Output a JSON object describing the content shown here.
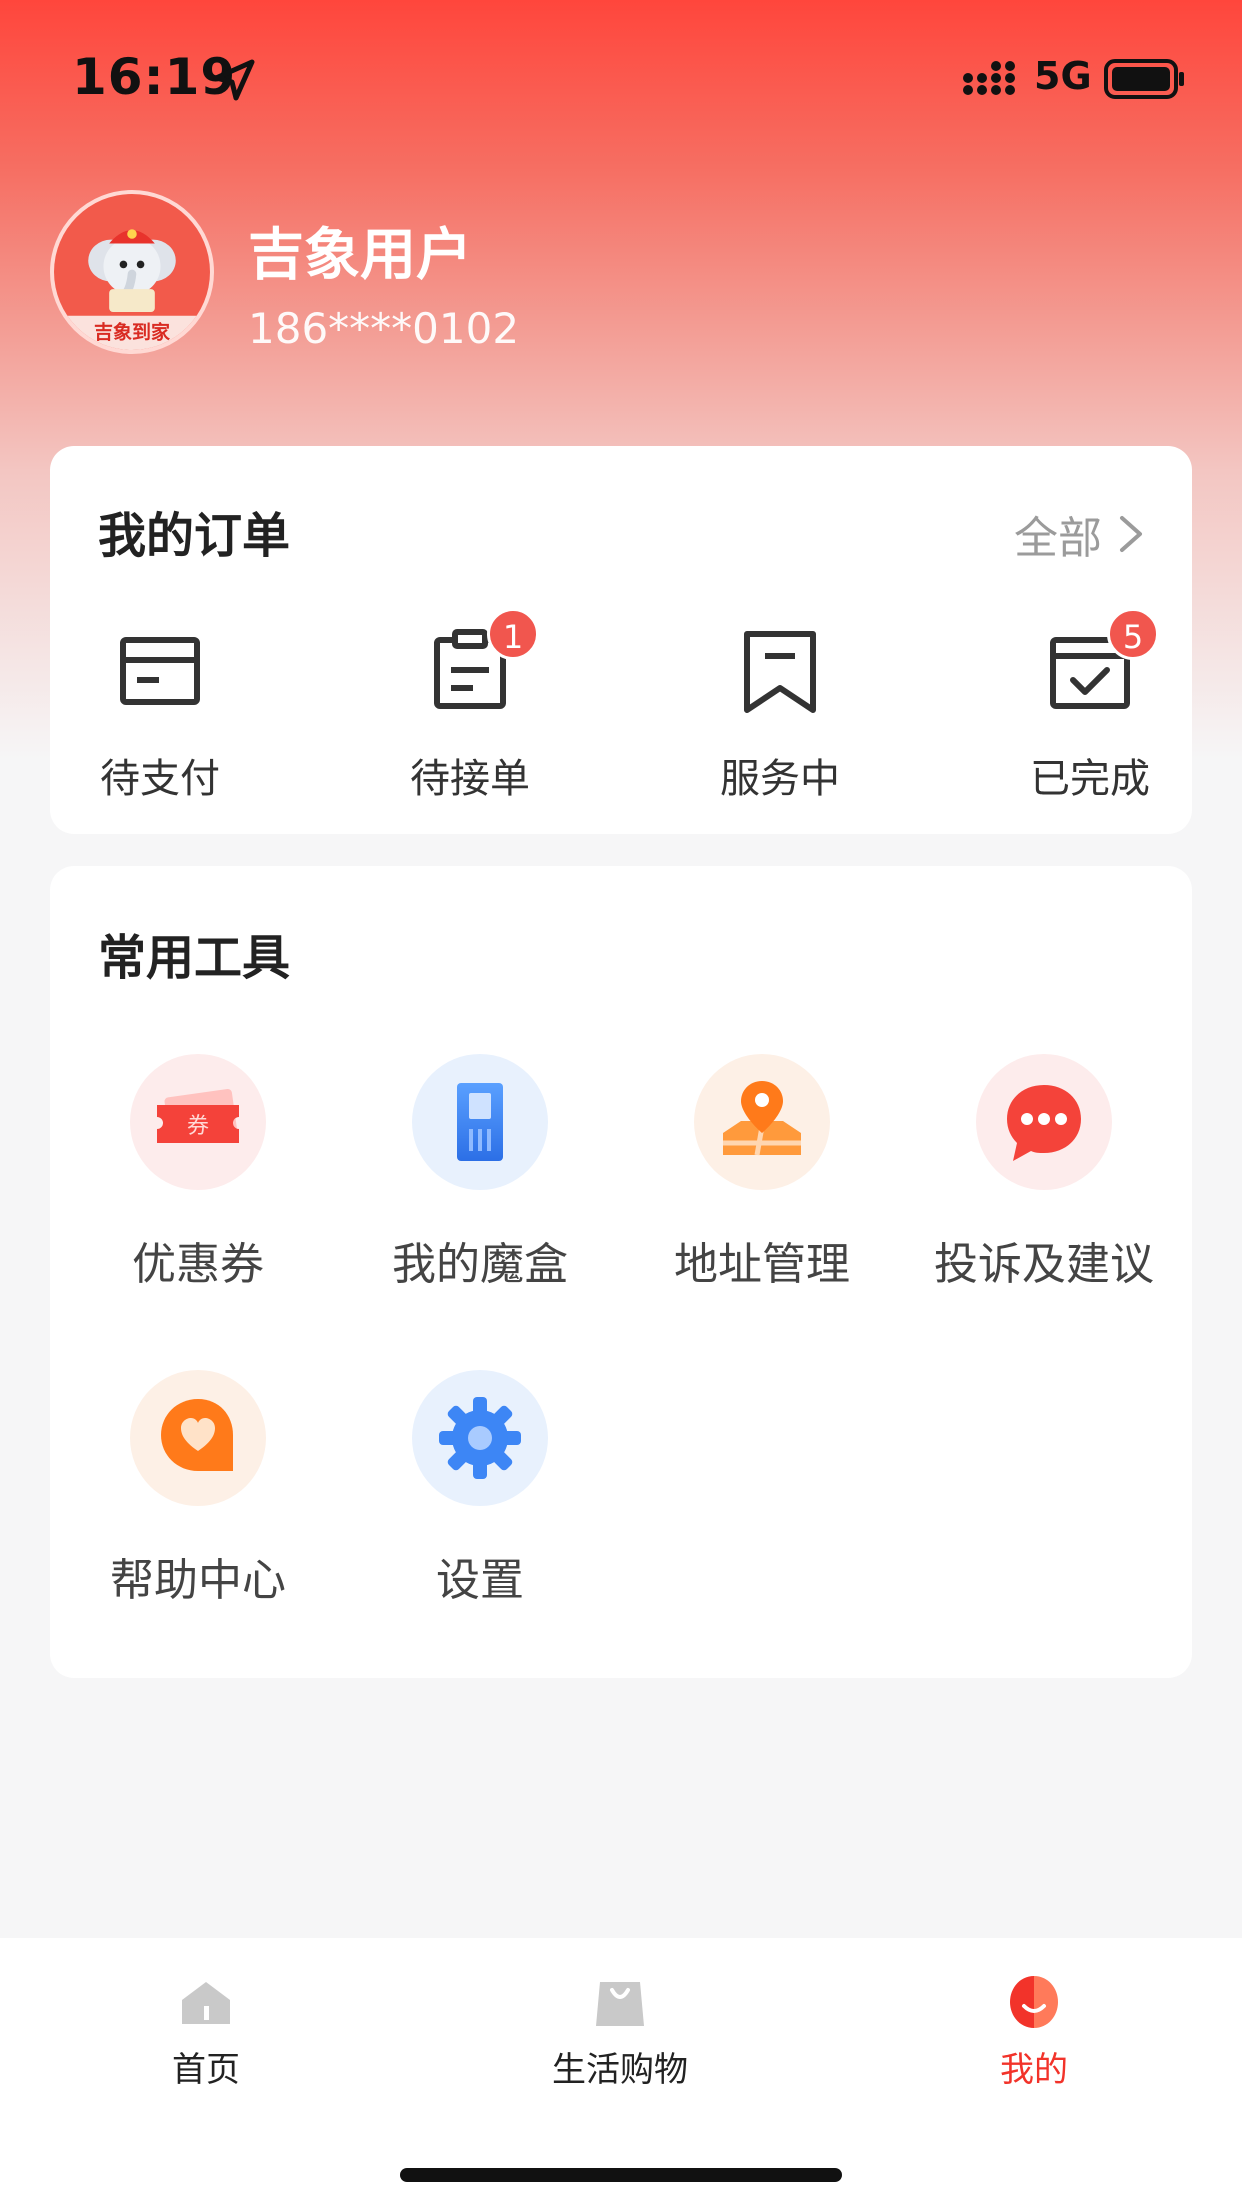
{
  "status_bar": {
    "time": "16:19",
    "network": "5G"
  },
  "profile": {
    "nickname": "吉象用户",
    "phone": "186****0102",
    "avatar_caption": "吉象到家"
  },
  "orders": {
    "title": "我的订单",
    "all_label": "全部",
    "items": [
      {
        "label": "待支付",
        "icon": "wallet-card-icon",
        "badge": ""
      },
      {
        "label": "待接单",
        "icon": "clipboard-icon",
        "badge": "1"
      },
      {
        "label": "服务中",
        "icon": "bookmark-icon",
        "badge": ""
      },
      {
        "label": "已完成",
        "icon": "calendar-check-icon",
        "badge": "5"
      }
    ]
  },
  "tools": {
    "title": "常用工具",
    "items": [
      {
        "label": "优惠券",
        "icon": "coupon-icon",
        "icon_text": "券"
      },
      {
        "label": "我的魔盒",
        "icon": "magic-box-icon"
      },
      {
        "label": "地址管理",
        "icon": "map-pin-icon"
      },
      {
        "label": "投诉及建议",
        "icon": "chat-bubble-icon"
      },
      {
        "label": "帮助中心",
        "icon": "heart-bubble-icon"
      },
      {
        "label": "设置",
        "icon": "gear-icon"
      }
    ]
  },
  "tabbar": {
    "items": [
      {
        "label": "首页",
        "icon": "home-icon",
        "active": false
      },
      {
        "label": "生活购物",
        "icon": "shopping-bag-icon",
        "active": false
      },
      {
        "label": "我的",
        "icon": "profile-icon",
        "active": true
      }
    ]
  },
  "colors": {
    "brand_red": "#f2332a",
    "badge_red": "#f1564e"
  }
}
